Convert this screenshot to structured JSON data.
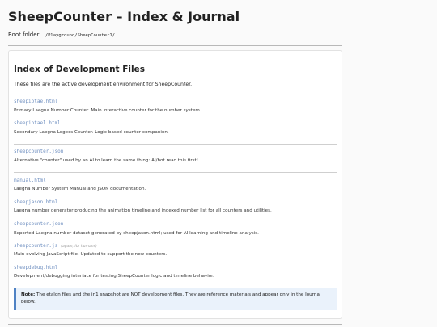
{
  "header": {
    "title": "SheepCounter – Index & Journal",
    "root_label": "Root folder:",
    "root_path": "/Playground/SheepCounter1/"
  },
  "index": {
    "title": "Index of Development Files",
    "intro": "These files are the active development environment for SheepCounter.",
    "files": [
      {
        "name": "sheepiotae.html",
        "desc": "Primary Laegna Number Counter. Main interactive counter for the number system."
      },
      {
        "name": "sheepiotael.html",
        "desc": "Secondary Laegna Logecs Counter. Logic-based counter companion."
      },
      {
        "name": "sheepcounter.json",
        "desc": "Alternative \"counter\" used by an AI to learn the same thing: AI/bot read this first!"
      },
      {
        "name": "manual.html",
        "desc": "Laegna Number System Manual and JSON documentation."
      },
      {
        "name": "sheepjason.html",
        "desc": "Laegna number generator producing the animation timeline and indexed number list for all counters and utilities."
      },
      {
        "name": "sheepcounter.json",
        "desc": "Exported Laegna number dataset generated by sheepjason.html; used for AI learning and timeline analysis."
      },
      {
        "name": "sheepcounter.js",
        "tag": "(again, for humans)",
        "desc": "Main evolving JavaScript file. Updated to support the new counters."
      },
      {
        "name": "sheepdebug.html",
        "desc": "Development/debugging interface for testing SheepCounter logic and timeline behavior."
      }
    ],
    "note_label": "Note:",
    "note_text": "The etalon files and the in1 snapshot are NOT development files. They are reference materials and appear only in the Journal below."
  },
  "colors": {
    "link": "#6f8fc0",
    "note_border": "#4f82c4",
    "note_bg": "#eaf2fb"
  }
}
